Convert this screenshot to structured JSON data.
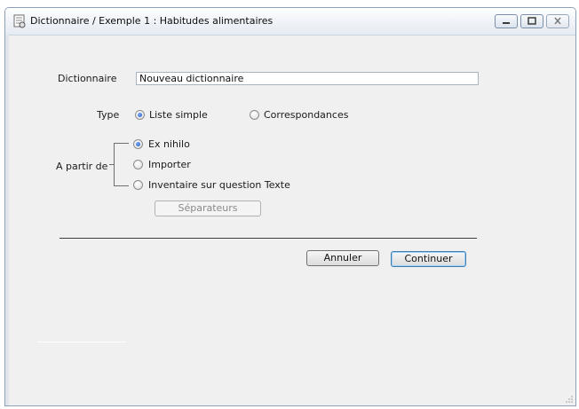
{
  "window": {
    "title": "Dictionnaire / Exemple 1 : Habitudes alimentaires",
    "icon": "app-icon"
  },
  "form": {
    "dictionary_label": "Dictionnaire",
    "dictionary_value": "Nouveau dictionnaire",
    "type_label": "Type",
    "type_options": [
      {
        "label": "Liste simple",
        "checked": true
      },
      {
        "label": "Correspondances",
        "checked": false
      }
    ],
    "source_label": "A partir de",
    "source_options": [
      {
        "label": "Ex nihilo",
        "checked": true
      },
      {
        "label": "Importer",
        "checked": false
      },
      {
        "label": "Inventaire sur question Texte",
        "checked": false
      }
    ],
    "separators_button": "Séparateurs"
  },
  "actions": {
    "cancel_label": "Annuler",
    "continue_label": "Continuer"
  },
  "colors": {
    "accent": "#1a4fb8",
    "window_bg": "#f0f0f0",
    "title_border": "#8ea0b8"
  }
}
